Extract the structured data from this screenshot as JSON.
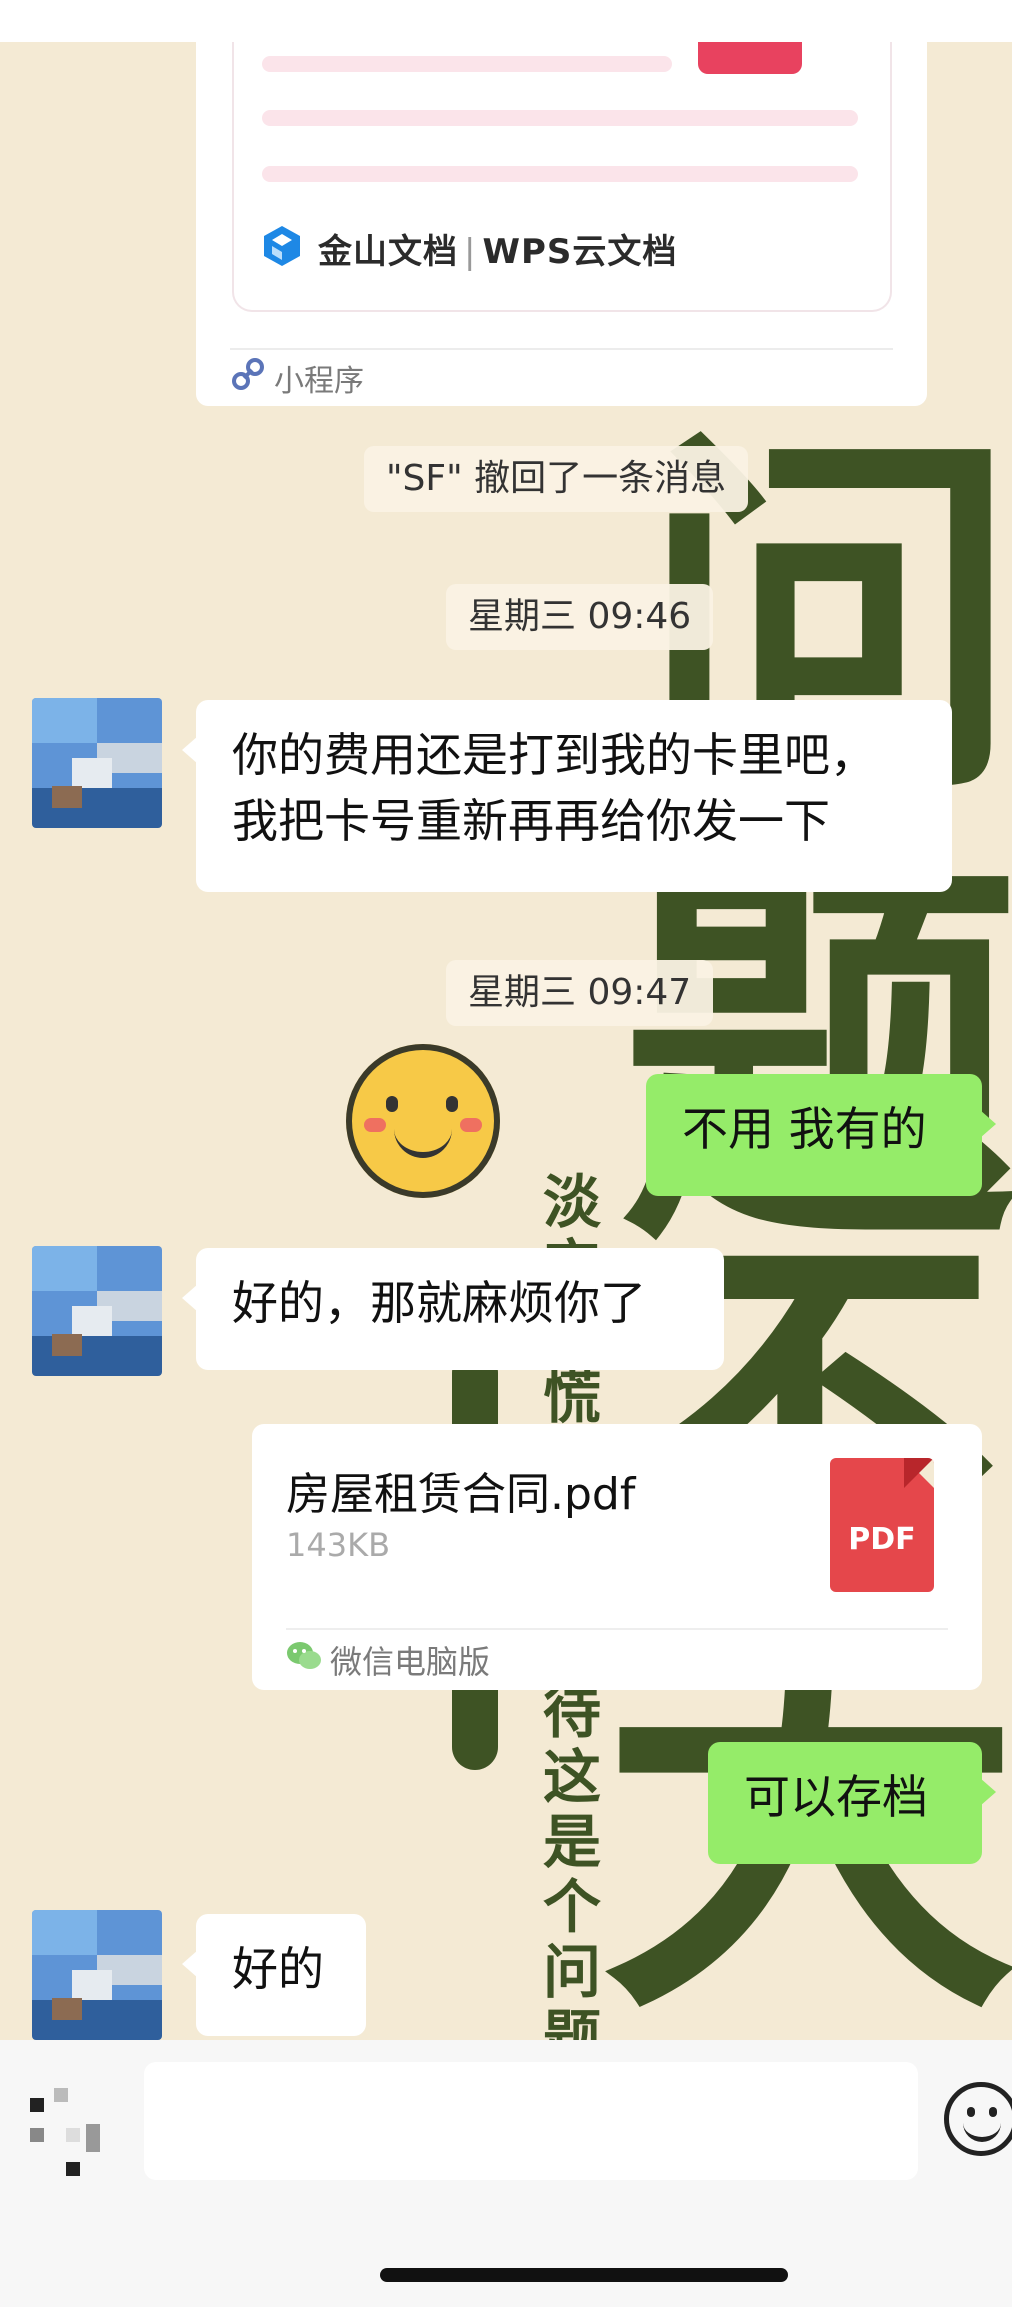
{
  "window": {
    "app": "WeChat chat"
  },
  "mini_program": {
    "brand_text": "金山文档",
    "brand_text2": "WPS云文档",
    "footer_label": "小程序"
  },
  "system_messages": {
    "recall": "\"SF\" 撤回了一条消息",
    "time1": "星期三 09:46",
    "time2": "星期三 09:47"
  },
  "messages": {
    "m1_line1": "你的费用还是打到我的卡里吧，",
    "m1_line2": "我把卡号重新再再给你发一下",
    "m2": "不用 我有的",
    "m3": "好的，那就麻烦你了",
    "m4": "可以存档",
    "m5": "好的"
  },
  "file": {
    "name": "房屋租赁合同.pdf",
    "size": "143KB",
    "type_label": "PDF",
    "source": "微信电脑版"
  },
  "background_text": {
    "big1": "问",
    "big2": "题",
    "big3": "不",
    "big4": "大",
    "vertical1": "淡定别慌",
    "vertical2": "待这是个问题"
  },
  "colors": {
    "outgoing_bubble": "#95ec69",
    "incoming_bubble": "#ffffff",
    "wallpaper": "#f4ead4",
    "calligraphy": "#3e5324",
    "pdf_icon": "#e5474b"
  },
  "icons": {
    "mini_program": "link-icon",
    "voice": "voice-icon",
    "emoji": "emoji-icon",
    "file_source": "wechat-icon"
  }
}
